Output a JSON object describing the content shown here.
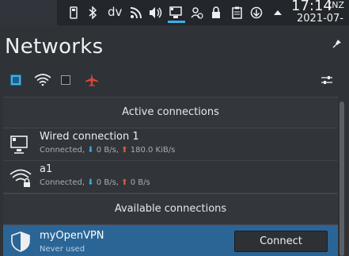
{
  "tray": {
    "bluetooth_text": "dv",
    "time": "17:14",
    "zone": "(NZ",
    "date": "2021-07-2"
  },
  "popup": {
    "title": "Networks"
  },
  "sections": {
    "active": "Active connections",
    "available": "Available connections"
  },
  "connections": {
    "wired": {
      "name": "Wired connection 1",
      "state": "Connected,",
      "down": "0 B/s,",
      "up": "180.0 KiB/s"
    },
    "wifi": {
      "name": "a1",
      "state": "Connected,",
      "down": "0 B/s,",
      "up": "0 B/s"
    },
    "vpn": {
      "name": "myOpenVPN",
      "state": "Never used",
      "button": "Connect"
    }
  },
  "colors": {
    "accent": "#3daee9",
    "selection": "#2b6596",
    "upload_arrow": "#e05a46",
    "airplane": "#e0453a"
  }
}
